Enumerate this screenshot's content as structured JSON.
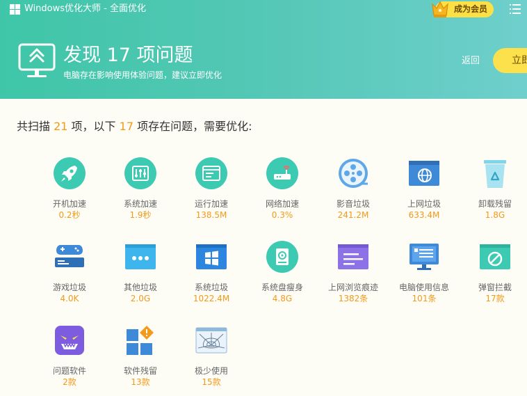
{
  "titlebar": {
    "app_title": "Windows优化大师 - 全面优化",
    "vip_label": "成为会员"
  },
  "hero": {
    "headline": "发现 17 项问题",
    "subline": "电脑存在影响使用体验问题，建议立即优化",
    "back_label": "返回",
    "optimize_label": "立即优化"
  },
  "summary": {
    "prefix": "共扫描 ",
    "scanned": "21",
    "middle": " 项，以下 ",
    "issues": "17",
    "suffix": " 项存在问题，需要优化:"
  },
  "items": [
    {
      "label": "开机加速",
      "value": "0.2秒",
      "icon": "rocket-icon"
    },
    {
      "label": "系统加速",
      "value": "1.9秒",
      "icon": "sliders-icon"
    },
    {
      "label": "运行加速",
      "value": "138.5M",
      "icon": "window-icon"
    },
    {
      "label": "网络加速",
      "value": "0.3%",
      "icon": "router-icon"
    },
    {
      "label": "影音垃圾",
      "value": "241.2M",
      "icon": "film-reel-icon"
    },
    {
      "label": "上网垃圾",
      "value": "633.4M",
      "icon": "globe-window-icon"
    },
    {
      "label": "卸载残留",
      "value": "1.8G",
      "icon": "recycle-bin-icon"
    },
    {
      "label": "游戏垃圾",
      "value": "4.0K",
      "icon": "gamepad-icon"
    },
    {
      "label": "其他垃圾",
      "value": "2.0G",
      "icon": "dots-window-icon"
    },
    {
      "label": "系统垃圾",
      "value": "1022.4M",
      "icon": "windows-logo-icon"
    },
    {
      "label": "系统盘瘦身",
      "value": "4.8G",
      "icon": "disk-icon"
    },
    {
      "label": "上网浏览痕迹",
      "value": "1382条",
      "icon": "browser-history-icon"
    },
    {
      "label": "电脑使用信息",
      "value": "101条",
      "icon": "monitor-list-icon"
    },
    {
      "label": "弹窗拦截",
      "value": "17款",
      "icon": "popup-block-icon"
    },
    {
      "label": "问题软件",
      "value": "2款",
      "icon": "devil-face-icon"
    },
    {
      "label": "软件残留",
      "value": "13款",
      "icon": "app-warning-icon"
    },
    {
      "label": "极少使用",
      "value": "15款",
      "icon": "cobweb-icon"
    }
  ],
  "colors": {
    "accent": "#f39a1b",
    "header_start": "#3fc6a8",
    "header_end": "#6fcfcc",
    "button_yellow": "#fde14c"
  }
}
